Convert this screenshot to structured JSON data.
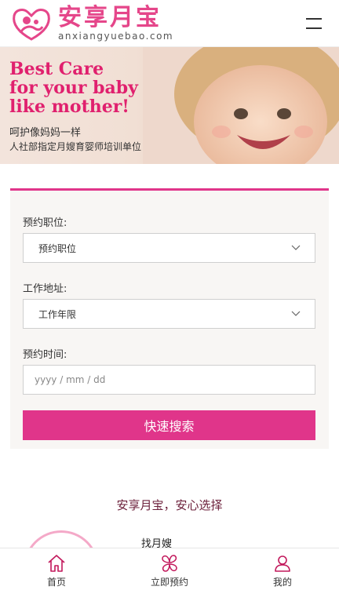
{
  "header": {
    "logo_cn": "安享月宝",
    "logo_en": "anxiangyuebao.com",
    "menu_icon": "hamburger-icon"
  },
  "banner": {
    "en_line1": "Best Care",
    "en_line2": "for your baby",
    "en_line3": "like mother!",
    "cn_line1": "呵护像妈妈一样",
    "cn_line2": "人社部指定月嫂育婴师培训单位"
  },
  "form": {
    "position_label": "预约职位:",
    "position_value": "预约职位",
    "location_label": "工作地址:",
    "location_value": "工作年限",
    "time_label": "预约时间:",
    "time_placeholder": "yyyy / mm / dd",
    "search_button": "快速搜索"
  },
  "slogan": "安享月宝，安心选择",
  "teaser": {
    "title": "找月嫂"
  },
  "nav": {
    "items": [
      {
        "label": "首页",
        "icon": "home-icon"
      },
      {
        "label": "立即预约",
        "icon": "clover-icon"
      },
      {
        "label": "我的",
        "icon": "user-icon"
      }
    ]
  },
  "colors": {
    "accent": "#e0358a",
    "logo_pink": "#e5468a",
    "banner_text": "#e0206e"
  }
}
